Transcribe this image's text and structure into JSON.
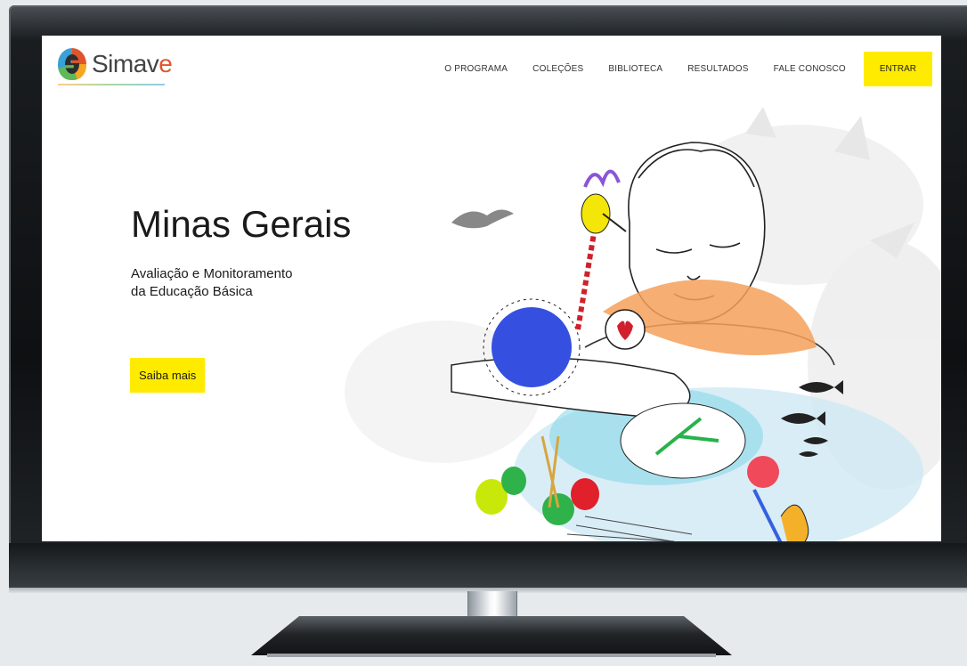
{
  "brand": {
    "name_main": "Simav",
    "name_accent": "e",
    "accent_color": "#e0542a"
  },
  "nav": {
    "items": [
      "O PROGRAMA",
      "COLEÇÕES",
      "BIBLIOTECA",
      "RESULTADOS",
      "FALE CONOSCO"
    ],
    "cta": "ENTRAR",
    "cta_color": "#ffeb00"
  },
  "hero": {
    "title": "Minas Gerais",
    "subtitle_line1": "Avaliação e Monitoramento",
    "subtitle_line2": "da Educação Básica",
    "button": "Saiba mais"
  }
}
